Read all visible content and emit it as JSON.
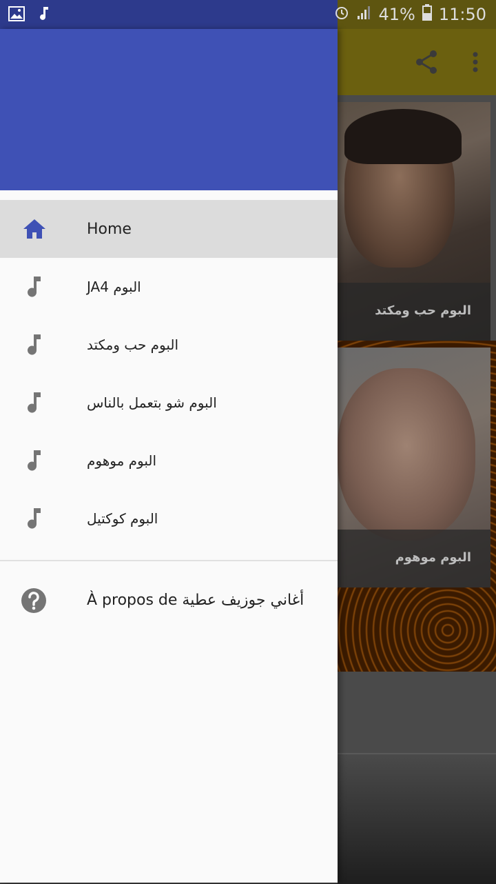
{
  "status_bar": {
    "battery": "41%",
    "time": "11:50",
    "left_icons": [
      "image-icon",
      "music-note-icon"
    ],
    "right_icons": [
      "alarm-icon",
      "signal-icon",
      "battery-icon"
    ]
  },
  "app": {
    "toolbar_icons": [
      "share-icon",
      "more-vert-icon"
    ],
    "cards": [
      {
        "caption": "البوم حب ومكتد"
      },
      {
        "caption": "البوم موهوم"
      }
    ]
  },
  "drawer": {
    "header_color": "#3f51b5",
    "items": [
      {
        "label": "Home",
        "icon": "home-icon",
        "active": true
      },
      {
        "label": "JA4 البوم",
        "icon": "music-note-icon"
      },
      {
        "label": "البوم حب ومكتد",
        "icon": "music-note-icon"
      },
      {
        "label": "البوم شو بتعمل بالناس",
        "icon": "music-note-icon"
      },
      {
        "label": "البوم موهوم",
        "icon": "music-note-icon"
      },
      {
        "label": "البوم كوكتيل",
        "icon": "music-note-icon"
      }
    ],
    "about": {
      "label": "À propos de أغاني جوزيف عطية",
      "icon": "help-icon"
    }
  }
}
